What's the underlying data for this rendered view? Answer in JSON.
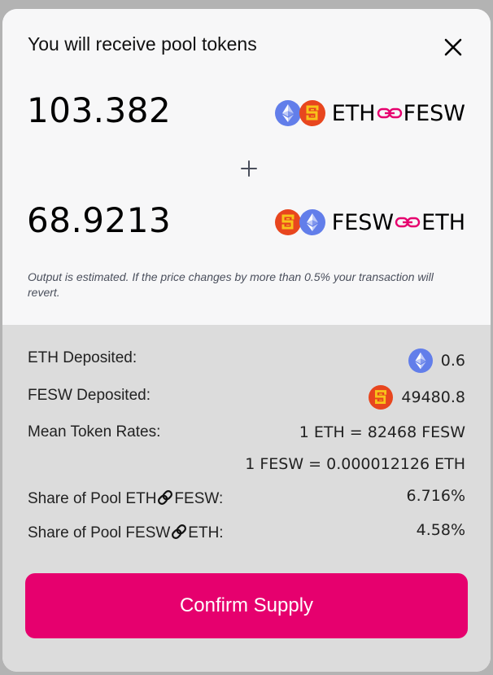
{
  "modal": {
    "title": "You will receive pool tokens"
  },
  "pool_a": {
    "amount": "103.382",
    "token_left": "ETH",
    "token_right": "FESW",
    "icons": [
      "eth-icon",
      "fesw-icon"
    ]
  },
  "pool_b": {
    "amount": "68.9213",
    "token_left": "FESW",
    "token_right": "ETH",
    "icons": [
      "fesw-icon",
      "eth-icon"
    ]
  },
  "note": "Output is estimated. If the price changes by more than 0.5% your transaction will revert.",
  "details": {
    "eth_deposited_label": "ETH Deposited:",
    "eth_deposited_value": "0.6",
    "fesw_deposited_label": "FESW Deposited:",
    "fesw_deposited_value": "49480.8",
    "rates_label": "Mean Token Rates:",
    "rate_1": "1 ETH = 82468 FESW",
    "rate_2": "1 FESW = 0.000012126 ETH",
    "share_1_label_prefix": "Share of Pool ETH",
    "share_1_label_suffix": "FESW:",
    "share_1_value": "6.716%",
    "share_2_label_prefix": "Share of Pool FESW",
    "share_2_label_suffix": "ETH:",
    "share_2_value": "4.58%"
  },
  "confirm_button": "Confirm Supply",
  "colors": {
    "accent": "#e6006e",
    "eth_blue": "#627eea",
    "fesw_red": "#e8461e",
    "fesw_yellow": "#f7c31a"
  }
}
